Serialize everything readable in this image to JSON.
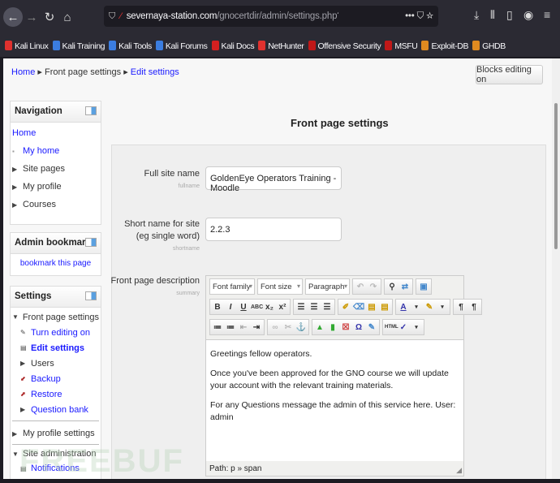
{
  "browser": {
    "url_host": "severnaya-station.com",
    "url_path": "/gnocertdir/admin/settings.php?section=frontpage",
    "bookmarks": [
      {
        "label": "Kali Linux",
        "color": "#e0312e"
      },
      {
        "label": "Kali Training",
        "color": "#3b7de0"
      },
      {
        "label": "Kali Tools",
        "color": "#3b7de0"
      },
      {
        "label": "Kali Forums",
        "color": "#3b7de0"
      },
      {
        "label": "Kali Docs",
        "color": "#d42020"
      },
      {
        "label": "NetHunter",
        "color": "#e0312e"
      },
      {
        "label": "Offensive Security",
        "color": "#c01818"
      },
      {
        "label": "MSFU",
        "color": "#c01818"
      },
      {
        "label": "Exploit-DB",
        "color": "#e08a20"
      },
      {
        "label": "GHDB",
        "color": "#e08a20"
      }
    ]
  },
  "breadcrumb": {
    "home": "Home",
    "section": "Front page settings",
    "current": "Edit settings"
  },
  "blocks_button": "Blocks editing on",
  "navigation": {
    "title": "Navigation",
    "home": "Home",
    "items": [
      "My home",
      "Site pages",
      "My profile",
      "Courses"
    ]
  },
  "admin_bookmarks": {
    "title": "Admin bookmarks",
    "link": "bookmark this page"
  },
  "settings": {
    "title": "Settings",
    "front": "Front page settings",
    "items": [
      "Turn editing on",
      "Edit settings",
      "Users",
      "Backup",
      "Restore",
      "Question bank"
    ],
    "profile": "My profile settings",
    "site_admin": "Site administration",
    "notifications": "Notifications"
  },
  "main": {
    "title": "Front page settings",
    "fullname": {
      "label": "Full site name",
      "key": "fullname",
      "value": "GoldenEye Operators Training - Moodle"
    },
    "shortname": {
      "label": "Short name for site (eg single word)",
      "key": "shortname",
      "value": "2.2.3"
    },
    "summary": {
      "label": "Front page description",
      "key": "summary"
    },
    "editor": {
      "font_family": "Font family",
      "font_size": "Font size",
      "format": "Paragraph",
      "paragraphs": [
        "Greetings fellow operators.",
        "Once you've been approved for the GNO course we will update your account with the relevant training materials.",
        "For any Questions message the admin of this service here. User: admin"
      ],
      "path": "Path: p » span"
    }
  },
  "watermark": "FREEBUF"
}
